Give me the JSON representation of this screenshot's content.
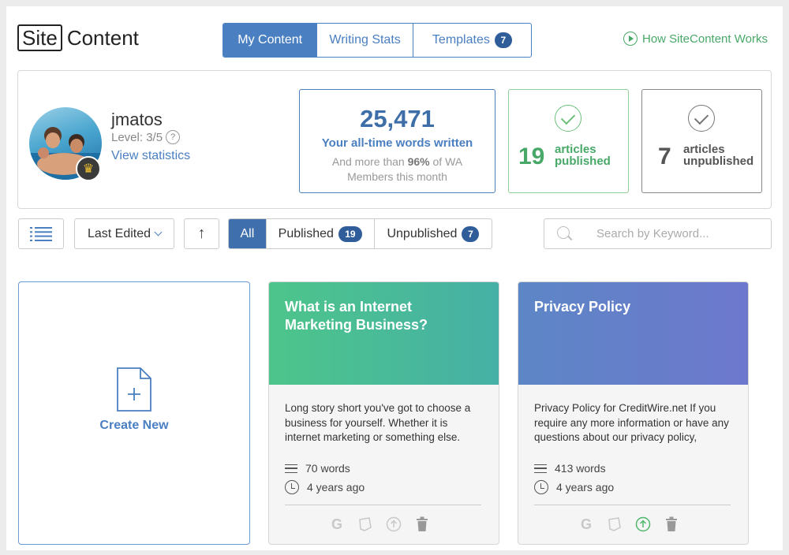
{
  "app": {
    "logo_box": "Site",
    "logo_rest": "Content"
  },
  "tabs": [
    {
      "label": "My Content",
      "active": true
    },
    {
      "label": "Writing Stats",
      "active": false
    },
    {
      "label": "Templates",
      "badge": "7",
      "active": false
    }
  ],
  "help_link": "How SiteContent Works",
  "user": {
    "name": "jmatos",
    "level": "Level: 3/5",
    "help_icon": "?",
    "view_stats": "View statistics"
  },
  "stats": {
    "words": "25,471",
    "words_label": "Your all-time words written",
    "comparison_pre": "And more than",
    "comparison_pct": "96%",
    "comparison_post": "of WA",
    "comparison_line2": "Members this month",
    "published_count": "19",
    "published_label_1": "articles",
    "published_label_2": "published",
    "unpublished_count": "7",
    "unpublished_label_1": "articles",
    "unpublished_label_2": "unpublished"
  },
  "toolbar": {
    "sort_label": "Last Edited",
    "sort_dir": "↑",
    "filters": [
      {
        "label": "All",
        "active": true
      },
      {
        "label": "Published",
        "badge": "19"
      },
      {
        "label": "Unpublished",
        "badge": "7"
      }
    ],
    "search_placeholder": "Search by Keyword..."
  },
  "create_new": "Create New",
  "articles": [
    {
      "title": "What is an Internet Marketing Business?",
      "excerpt": "Long story short you've got to choose a business for yourself. Whether it is internet marketing or something else.",
      "words": "70 words",
      "age": "4 years ago",
      "actions": [
        "G",
        "note",
        "publish",
        "trash"
      ]
    },
    {
      "title": "Privacy Policy",
      "excerpt": "Privacy Policy for CreditWire.net If you require any more information or have any questions about our privacy policy,",
      "words": "413 words",
      "age": "4 years ago",
      "actions": [
        "G",
        "note",
        "publish",
        "trash"
      ]
    }
  ],
  "colors": {
    "accent": "#4a7fc1",
    "green": "#48a868",
    "badge": "#2f5d9a"
  }
}
